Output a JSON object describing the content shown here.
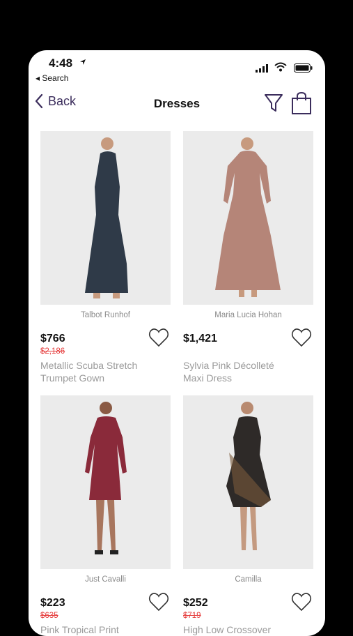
{
  "status_bar": {
    "time": "4:48",
    "back_app": "◂ Search"
  },
  "nav": {
    "back_label": "Back",
    "title": "Dresses"
  },
  "products": [
    {
      "brand": "Talbot Runhof",
      "price": "$766",
      "original_price": "$2,186",
      "name_line1": "Metallic Scuba Stretch",
      "name_line2": "Trumpet Gown",
      "dress_color": "#2f3a48"
    },
    {
      "brand": "Maria Lucia Hohan",
      "price": "$1,421",
      "original_price": "",
      "name_line1": "Sylvia Pink Décolleté",
      "name_line2": "Maxi Dress",
      "dress_color": "#b58578"
    },
    {
      "brand": "Just Cavalli",
      "price": "$223",
      "original_price": "$635",
      "name_line1": "Pink Tropical Print",
      "name_line2": "",
      "dress_color": "#8a2a3a"
    },
    {
      "brand": "Camilla",
      "price": "$252",
      "original_price": "$719",
      "name_line1": "High Low Crossover",
      "name_line2": "",
      "dress_color": "#2e2a28"
    }
  ],
  "colors": {
    "accent": "#3b2d5c",
    "sale": "#e53b3b"
  }
}
